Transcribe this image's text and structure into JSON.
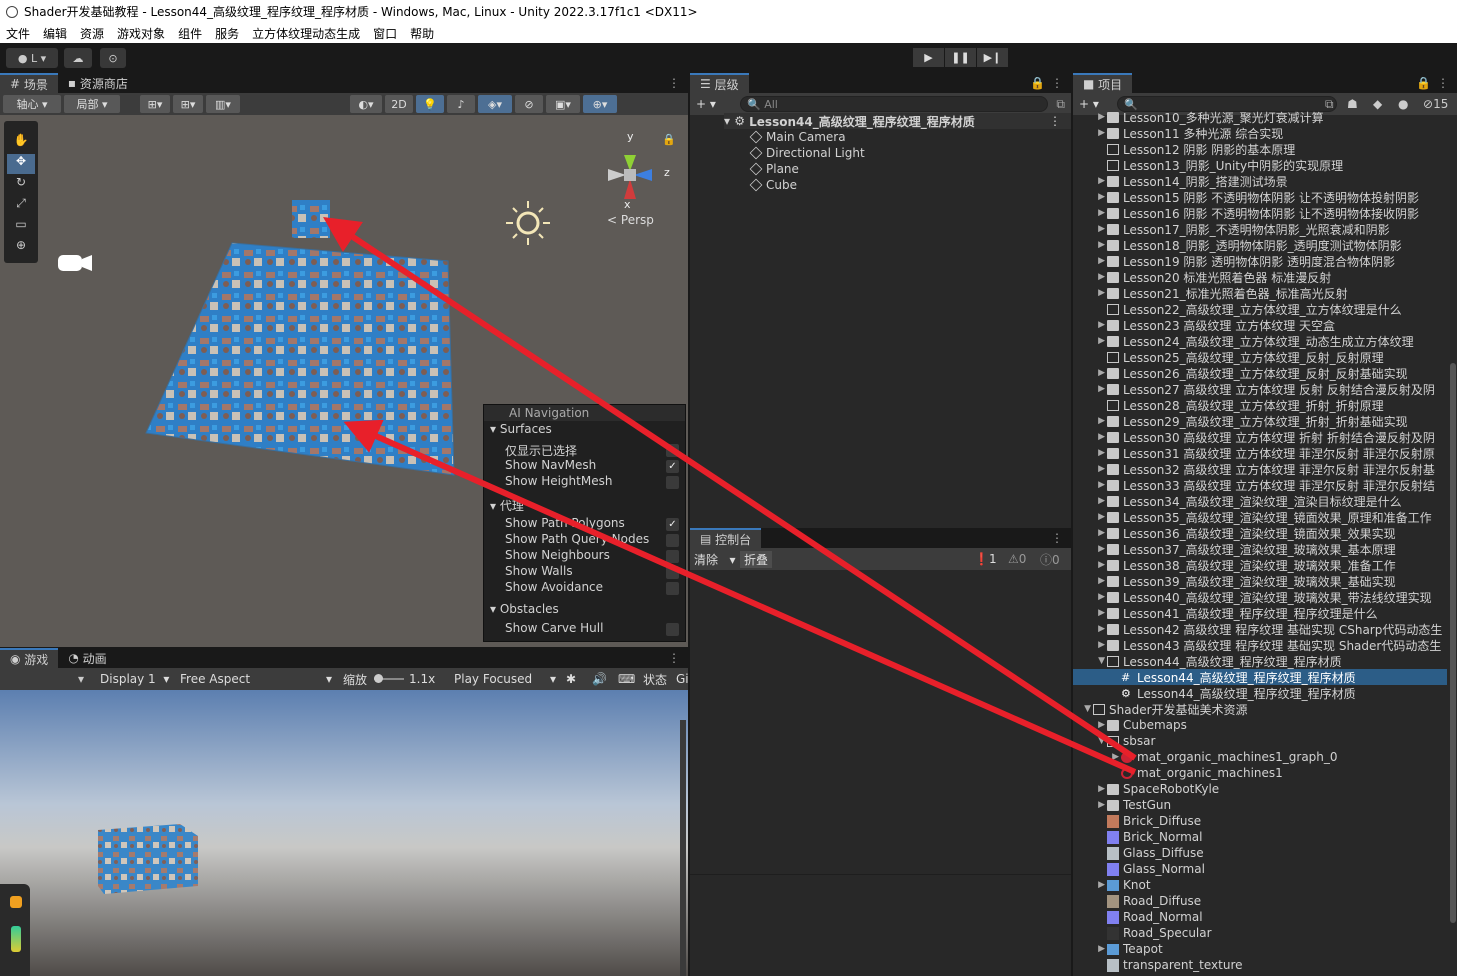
{
  "window": {
    "title": "Shader开发基础教程 - Lesson44_高级纹理_程序纹理_程序材质 - Windows, Mac, Linux - Unity 2022.3.17f1c1 <DX11>"
  },
  "menu": [
    "文件",
    "编辑",
    "资源",
    "游戏对象",
    "组件",
    "服务",
    "立方体纹理动态生成",
    "窗口",
    "帮助"
  ],
  "toolbar": {
    "account": "L"
  },
  "scene": {
    "tabs": [
      "场景",
      "资源商店"
    ],
    "pivot": "轴心",
    "local": "局部",
    "mode2d": "2D",
    "gizmo": {
      "y": "y",
      "z": "z",
      "x": "x",
      "persp": "Persp"
    },
    "ai_nav": {
      "title": "AI Navigation",
      "surfaces": "Surfaces",
      "surface_items": [
        {
          "label": "仅显示已选择",
          "checked": false
        },
        {
          "label": "Show NavMesh",
          "checked": true
        },
        {
          "label": "Show HeightMesh",
          "checked": false
        }
      ],
      "agents": "代理",
      "agent_items": [
        {
          "label": "Show Path Polygons",
          "checked": true
        },
        {
          "label": "Show Path Query Nodes",
          "checked": false
        },
        {
          "label": "Show Neighbours",
          "checked": false
        },
        {
          "label": "Show Walls",
          "checked": false
        },
        {
          "label": "Show Avoidance",
          "checked": false
        }
      ],
      "obstacles": "Obstacles",
      "obstacle_items": [
        {
          "label": "Show Carve Hull",
          "checked": false
        }
      ]
    }
  },
  "game": {
    "tabs": [
      "游戏",
      "动画"
    ],
    "display": "Display 1",
    "aspect": "Free Aspect",
    "scale_label": "缩放",
    "scale_value": "1.1x",
    "play_mode": "Play Focused",
    "stats": "状态",
    "gizmos": "Gi"
  },
  "hierarchy": {
    "tab": "层级",
    "search_placeholder": "All",
    "scene": "Lesson44_高级纹理_程序纹理_程序材质",
    "items": [
      "Main Camera",
      "Directional Light",
      "Plane",
      "Cube"
    ]
  },
  "console": {
    "tab": "控制台",
    "clear": "清除",
    "collapse": "折叠",
    "errors": "1",
    "warnings": "0",
    "infos": "0"
  },
  "project": {
    "tab": "项目",
    "count": "15",
    "items": [
      {
        "label": "Lesson10_多种光源_聚光灯衰减计算",
        "indent": 1,
        "type": "folder",
        "arrow": "right"
      },
      {
        "label": "Lesson11 多种光源 综合实现",
        "indent": 1,
        "type": "folder",
        "arrow": "right"
      },
      {
        "label": "Lesson12 阴影 阴影的基本原理",
        "indent": 1,
        "type": "folder-empty",
        "arrow": ""
      },
      {
        "label": "Lesson13_阴影_Unity中阴影的实现原理",
        "indent": 1,
        "type": "folder-empty",
        "arrow": ""
      },
      {
        "label": "Lesson14_阴影_搭建测试场景",
        "indent": 1,
        "type": "folder",
        "arrow": "right"
      },
      {
        "label": "Lesson15 阴影 不透明物体阴影 让不透明物体投射阴影",
        "indent": 1,
        "type": "folder",
        "arrow": "right"
      },
      {
        "label": "Lesson16 阴影 不透明物体阴影 让不透明物体接收阴影",
        "indent": 1,
        "type": "folder",
        "arrow": "right"
      },
      {
        "label": "Lesson17_阴影_不透明物体阴影_光照衰减和阴影",
        "indent": 1,
        "type": "folder",
        "arrow": "right"
      },
      {
        "label": "Lesson18_阴影_透明物体阴影_透明度测试物体阴影",
        "indent": 1,
        "type": "folder",
        "arrow": "right"
      },
      {
        "label": "Lesson19 阴影 透明物体阴影 透明度混合物体阴影",
        "indent": 1,
        "type": "folder",
        "arrow": "right"
      },
      {
        "label": "Lesson20 标准光照着色器 标准漫反射",
        "indent": 1,
        "type": "folder",
        "arrow": "right"
      },
      {
        "label": "Lesson21_标准光照着色器_标准高光反射",
        "indent": 1,
        "type": "folder",
        "arrow": "right"
      },
      {
        "label": "Lesson22_高级纹理_立方体纹理_立方体纹理是什么",
        "indent": 1,
        "type": "folder-empty",
        "arrow": ""
      },
      {
        "label": "Lesson23 高级纹理 立方体纹理 天空盒",
        "indent": 1,
        "type": "folder",
        "arrow": "right"
      },
      {
        "label": "Lesson24_高级纹理_立方体纹理_动态生成立方体纹理",
        "indent": 1,
        "type": "folder",
        "arrow": "right"
      },
      {
        "label": "Lesson25_高级纹理_立方体纹理_反射_反射原理",
        "indent": 1,
        "type": "folder-empty",
        "arrow": ""
      },
      {
        "label": "Lesson26_高级纹理_立方体纹理_反射_反射基础实现",
        "indent": 1,
        "type": "folder",
        "arrow": "right"
      },
      {
        "label": "Lesson27 高级纹理 立方体纹理 反射 反射结合漫反射及阴",
        "indent": 1,
        "type": "folder",
        "arrow": "right"
      },
      {
        "label": "Lesson28_高级纹理_立方体纹理_折射_折射原理",
        "indent": 1,
        "type": "folder-empty",
        "arrow": ""
      },
      {
        "label": "Lesson29_高级纹理_立方体纹理_折射_折射基础实现",
        "indent": 1,
        "type": "folder",
        "arrow": "right"
      },
      {
        "label": "Lesson30 高级纹理 立方体纹理 折射 折射结合漫反射及阴",
        "indent": 1,
        "type": "folder",
        "arrow": "right"
      },
      {
        "label": "Lesson31 高级纹理 立方体纹理 菲涅尔反射 菲涅尔反射原",
        "indent": 1,
        "type": "folder",
        "arrow": "right"
      },
      {
        "label": "Lesson32 高级纹理 立方体纹理 菲涅尔反射 菲涅尔反射基",
        "indent": 1,
        "type": "folder",
        "arrow": "right"
      },
      {
        "label": "Lesson33 高级纹理 立方体纹理 菲涅尔反射 菲涅尔反射结",
        "indent": 1,
        "type": "folder",
        "arrow": "right"
      },
      {
        "label": "Lesson34_高级纹理_渲染纹理_渲染目标纹理是什么",
        "indent": 1,
        "type": "folder",
        "arrow": "right"
      },
      {
        "label": "Lesson35_高级纹理_渲染纹理_镜面效果_原理和准备工作",
        "indent": 1,
        "type": "folder",
        "arrow": "right"
      },
      {
        "label": "Lesson36_高级纹理_渲染纹理_镜面效果_效果实现",
        "indent": 1,
        "type": "folder",
        "arrow": "right"
      },
      {
        "label": "Lesson37_高级纹理_渲染纹理_玻璃效果_基本原理",
        "indent": 1,
        "type": "folder",
        "arrow": "right"
      },
      {
        "label": "Lesson38_高级纹理_渲染纹理_玻璃效果_准备工作",
        "indent": 1,
        "type": "folder",
        "arrow": "right"
      },
      {
        "label": "Lesson39_高级纹理_渲染纹理_玻璃效果_基础实现",
        "indent": 1,
        "type": "folder",
        "arrow": "right"
      },
      {
        "label": "Lesson40_高级纹理_渲染纹理_玻璃效果_带法线纹理实现",
        "indent": 1,
        "type": "folder",
        "arrow": "right"
      },
      {
        "label": "Lesson41_高级纹理_程序纹理_程序纹理是什么",
        "indent": 1,
        "type": "folder",
        "arrow": "right"
      },
      {
        "label": "Lesson42 高级纹理 程序纹理 基础实现 CSharp代码动态生",
        "indent": 1,
        "type": "folder",
        "arrow": "right"
      },
      {
        "label": "Lesson43 高级纹理 程序纹理 基础实现 Shader代码动态生",
        "indent": 1,
        "type": "folder",
        "arrow": "right"
      },
      {
        "label": "Lesson44_高级纹理_程序纹理_程序材质",
        "indent": 1,
        "type": "folder-open",
        "arrow": "down"
      },
      {
        "label": "Lesson44_高级纹理_程序纹理_程序材质",
        "indent": 2,
        "type": "script",
        "arrow": "",
        "selected": true
      },
      {
        "label": "Lesson44_高级纹理_程序纹理_程序材质",
        "indent": 2,
        "type": "scene",
        "arrow": ""
      },
      {
        "label": "Shader开发基础美术资源",
        "indent": 0,
        "type": "folder-open",
        "arrow": "down"
      },
      {
        "label": "Cubemaps",
        "indent": 1,
        "type": "folder",
        "arrow": "right"
      },
      {
        "label": "sbsar",
        "indent": 1,
        "type": "folder-open",
        "arrow": "down"
      },
      {
        "label": "mat_organic_machines1_graph_0",
        "indent": 2,
        "type": "material",
        "arrow": "right"
      },
      {
        "label": "mat_organic_machines1",
        "indent": 2,
        "type": "substance",
        "arrow": ""
      },
      {
        "label": "SpaceRobotKyle",
        "indent": 1,
        "type": "folder",
        "arrow": "right"
      },
      {
        "label": "TestGun",
        "indent": 1,
        "type": "folder",
        "arrow": "right"
      },
      {
        "label": "Brick_Diffuse",
        "indent": 1,
        "type": "tex-brick",
        "arrow": ""
      },
      {
        "label": "Brick_Normal",
        "indent": 1,
        "type": "tex-normal",
        "arrow": ""
      },
      {
        "label": "Glass_Diffuse",
        "indent": 1,
        "type": "tex-glass",
        "arrow": ""
      },
      {
        "label": "Glass_Normal",
        "indent": 1,
        "type": "tex-normal",
        "arrow": ""
      },
      {
        "label": "Knot",
        "indent": 1,
        "type": "model",
        "arrow": "right"
      },
      {
        "label": "Road_Diffuse",
        "indent": 1,
        "type": "tex-road",
        "arrow": ""
      },
      {
        "label": "Road_Normal",
        "indent": 1,
        "type": "tex-normal",
        "arrow": ""
      },
      {
        "label": "Road_Specular",
        "indent": 1,
        "type": "tex-dark",
        "arrow": ""
      },
      {
        "label": "Teapot",
        "indent": 1,
        "type": "model",
        "arrow": "right"
      },
      {
        "label": "transparent_texture",
        "indent": 1,
        "type": "tex-glass",
        "arrow": ""
      }
    ]
  },
  "colors": {
    "accent": "#3a79bb",
    "selection": "#2c5d87",
    "annotation_arrow": "#e8202a"
  }
}
